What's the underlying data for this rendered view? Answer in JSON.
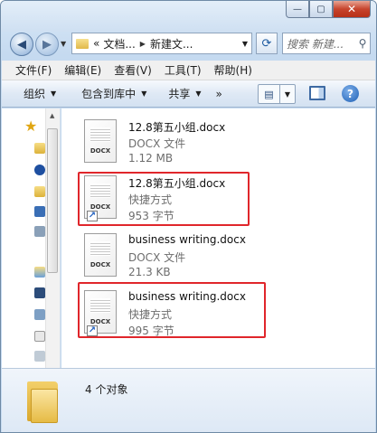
{
  "window": {
    "caption_buttons": {
      "minimize": "—",
      "maximize": "▢",
      "close": "✕"
    }
  },
  "nav": {
    "back_glyph": "◀",
    "forward_glyph": "▶",
    "history_drop": "▼",
    "address": {
      "overflow": "«",
      "crumbs": [
        "文档...",
        "新建文..."
      ],
      "separator": "▶",
      "drop": "▼"
    },
    "refresh_glyph": "⟳",
    "search": {
      "placeholder": "搜索 新建...",
      "icon": "search-icon"
    }
  },
  "menu": {
    "items": [
      "文件(F)",
      "编辑(E)",
      "查看(V)",
      "工具(T)",
      "帮助(H)"
    ]
  },
  "commands": {
    "organize": "组织",
    "include_library": "包含到库中",
    "share": "共享",
    "more": "»",
    "dropdown_glyph": "▼"
  },
  "files": [
    {
      "name": "12.8第五小组.docx",
      "type": "DOCX 文件",
      "size": "1.12 MB",
      "icon_label": "DOCX",
      "shortcut": false,
      "highlighted": false
    },
    {
      "name": "12.8第五小组.docx",
      "type": "快捷方式",
      "size": "953 字节",
      "icon_label": "DOCX",
      "shortcut": true,
      "highlighted": true
    },
    {
      "name": "business writing.docx",
      "type": "DOCX 文件",
      "size": "21.3 KB",
      "icon_label": "DOCX",
      "shortcut": false,
      "highlighted": false
    },
    {
      "name": "business writing.docx",
      "type": "快捷方式",
      "size": "995 字节",
      "icon_label": "DOCX",
      "shortcut": true,
      "highlighted": true
    }
  ],
  "status": {
    "object_count": "4 个对象"
  },
  "colors": {
    "highlight": "#e0262b",
    "accent": "#1d5fb5"
  }
}
